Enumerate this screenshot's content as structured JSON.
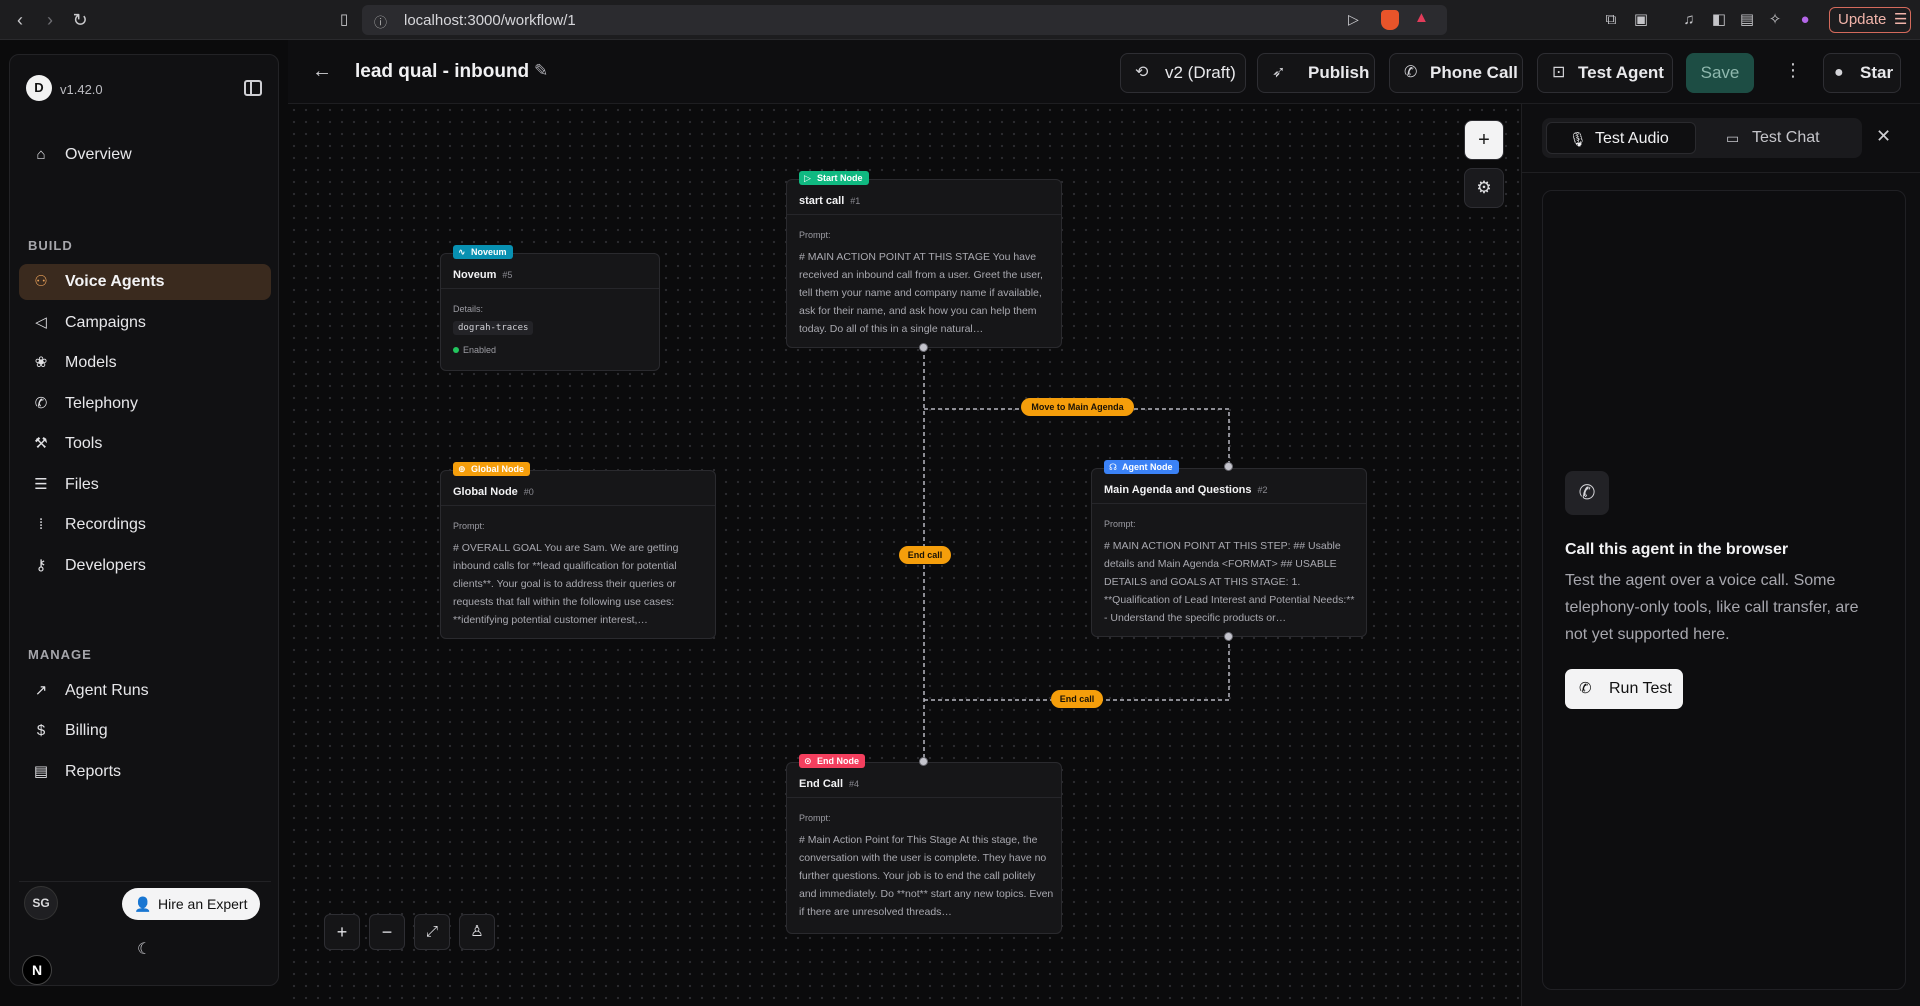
{
  "browser": {
    "url": "localhost:3000/workflow/1",
    "update_label": "Update"
  },
  "sidebar": {
    "version": "v1.42.0",
    "logo_text": "D",
    "build_label": "BUILD",
    "manage_label": "MANAGE",
    "build_items": [
      {
        "label": "Overview",
        "icon": "home-icon"
      },
      {
        "label": "Voice Agents",
        "icon": "workflow-icon"
      },
      {
        "label": "Campaigns",
        "icon": "megaphone-icon"
      },
      {
        "label": "Models",
        "icon": "brain-icon"
      },
      {
        "label": "Telephony",
        "icon": "phone-icon"
      },
      {
        "label": "Tools",
        "icon": "wrench-icon"
      },
      {
        "label": "Files",
        "icon": "database-icon"
      },
      {
        "label": "Recordings",
        "icon": "audio-lines-icon"
      },
      {
        "label": "Developers",
        "icon": "key-icon"
      }
    ],
    "manage_items": [
      {
        "label": "Agent Runs",
        "icon": "trending-icon"
      },
      {
        "label": "Billing",
        "icon": "dollar-icon"
      },
      {
        "label": "Reports",
        "icon": "file-icon"
      }
    ],
    "user_initials": "SG",
    "hire_label": "Hire an Expert",
    "n_badge": "N"
  },
  "header": {
    "title": "lead qual - inbound",
    "version_label": "v2 (Draft)",
    "publish_label": "Publish",
    "phone_call_label": "Phone Call",
    "test_agent_label": "Test Agent",
    "save_label": "Save",
    "star_label": "Star"
  },
  "nodes": {
    "start": {
      "tag": "Start Node",
      "title": "start call",
      "id": "#1",
      "prompt_label": "Prompt:",
      "prompt": "# MAIN ACTION POINT AT THIS STAGE You have received an inbound call from a user. Greet the user, tell them your name and company name if available, ask for their name, and ask how you can help them today. Do all of this in a single natural…"
    },
    "noveum": {
      "tag": "Noveum",
      "title": "Noveum",
      "id": "#5",
      "details_label": "Details:",
      "details_value": "dograh-traces",
      "status": "Enabled"
    },
    "global": {
      "tag": "Global Node",
      "title": "Global Node",
      "id": "#0",
      "prompt_label": "Prompt:",
      "prompt": "# OVERALL GOAL You are Sam. We are getting inbound calls for **lead qualification for potential clients**. Your goal is to address their queries or requests that fall within the following use cases: **identifying potential customer interest,…"
    },
    "agent": {
      "tag": "Agent Node",
      "title": "Main Agenda and Questions",
      "id": "#2",
      "prompt_label": "Prompt:",
      "prompt": "# MAIN ACTION POINT AT THIS STEP: ## Usable details and Main Agenda <FORMAT> ## USABLE DETAILS and GOALS AT THIS STAGE: 1. **Qualification of Lead Interest and Potential Needs:** - Understand the specific products or…"
    },
    "end": {
      "tag": "End Node",
      "title": "End Call",
      "id": "#4",
      "prompt_label": "Prompt:",
      "prompt": "# Main Action Point for This Stage At this stage, the conversation with the user is complete. They have no further questions. Your job is to end the call politely and immediately. Do **not** start any new topics. Even if there are unresolved threads…"
    }
  },
  "edges": {
    "move_label": "Move to Main Agenda",
    "end_call_label_1": "End call",
    "end_call_label_2": "End call"
  },
  "colors": {
    "start_tag": "#10b981",
    "noveum_tag": "#0891b2",
    "global_tag": "#f59e0b",
    "agent_tag": "#3b82f6",
    "end_tag": "#f43f5e",
    "edge_pill": "#f59e0b",
    "save_bg": "#1d4d44"
  },
  "panel": {
    "tab_audio": "Test Audio",
    "tab_chat": "Test Chat",
    "call_title": "Call this agent in the browser",
    "call_desc": "Test the agent over a voice call. Some telephony-only tools, like call transfer, are not yet supported here.",
    "run_label": "Run Test"
  }
}
